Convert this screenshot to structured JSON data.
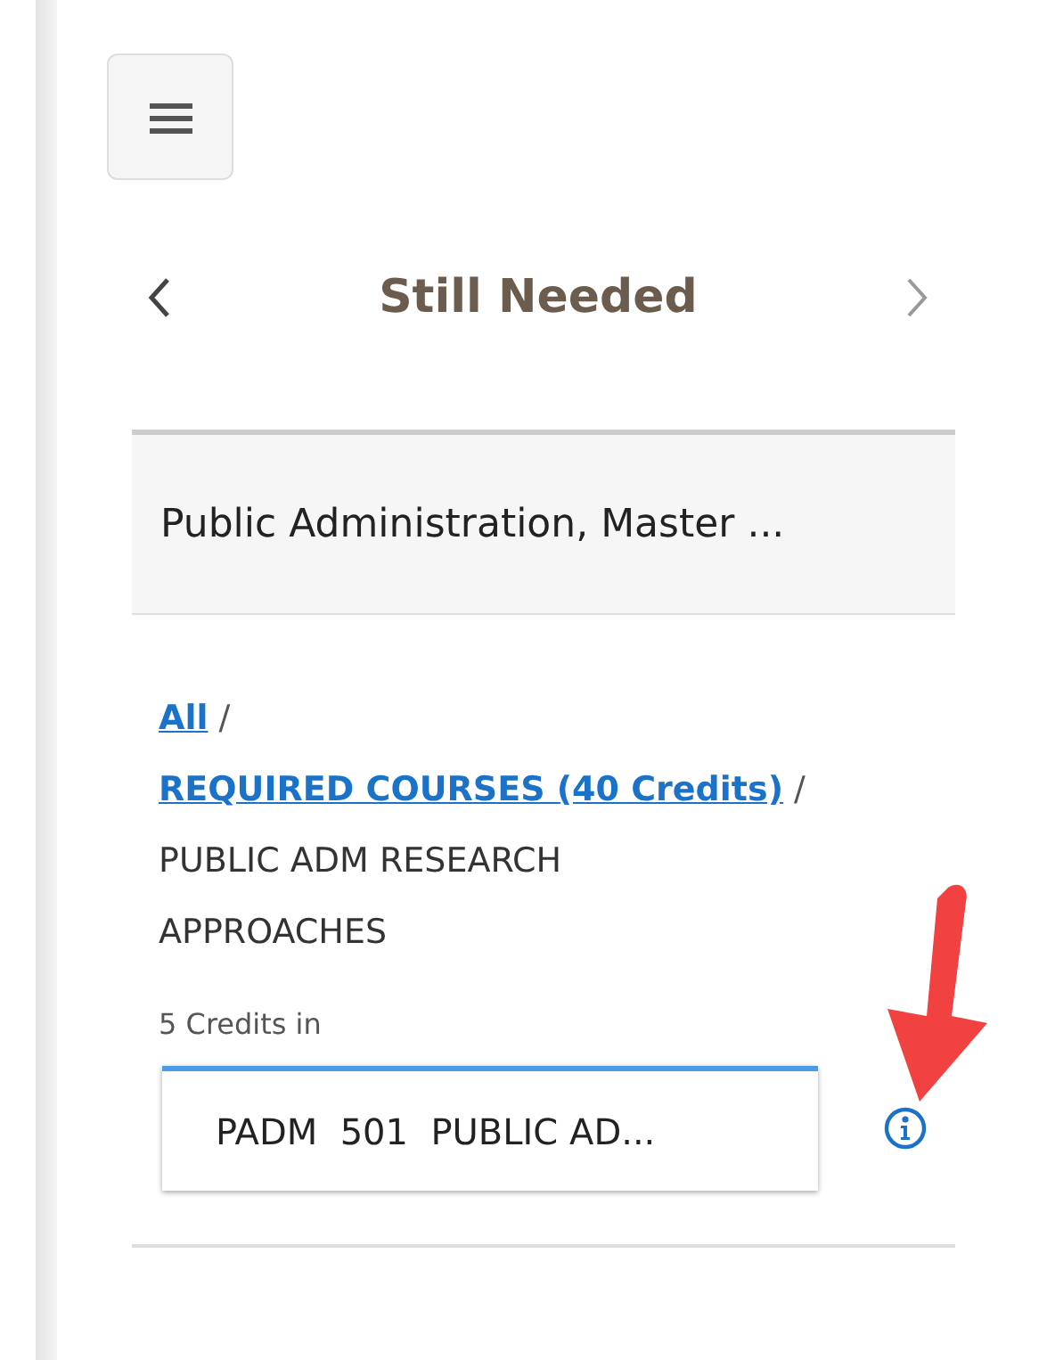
{
  "header": {
    "title": "Still Needed"
  },
  "block": {
    "title": "Public Administration, Master ..."
  },
  "breadcrumb": [
    {
      "kind": "link",
      "label": "All"
    },
    {
      "kind": "separator",
      "label": "/"
    },
    {
      "kind": "link",
      "label": "REQUIRED COURSES (40 Credits)"
    },
    {
      "kind": "separator",
      "label": "/"
    },
    {
      "kind": "text",
      "label": "PUBLIC ADM RESEARCH APPROACHES"
    }
  ],
  "requirement": {
    "label": "5 Credits in",
    "courses": [
      {
        "label": "PADM  501  PUBLIC AD..."
      }
    ]
  }
}
